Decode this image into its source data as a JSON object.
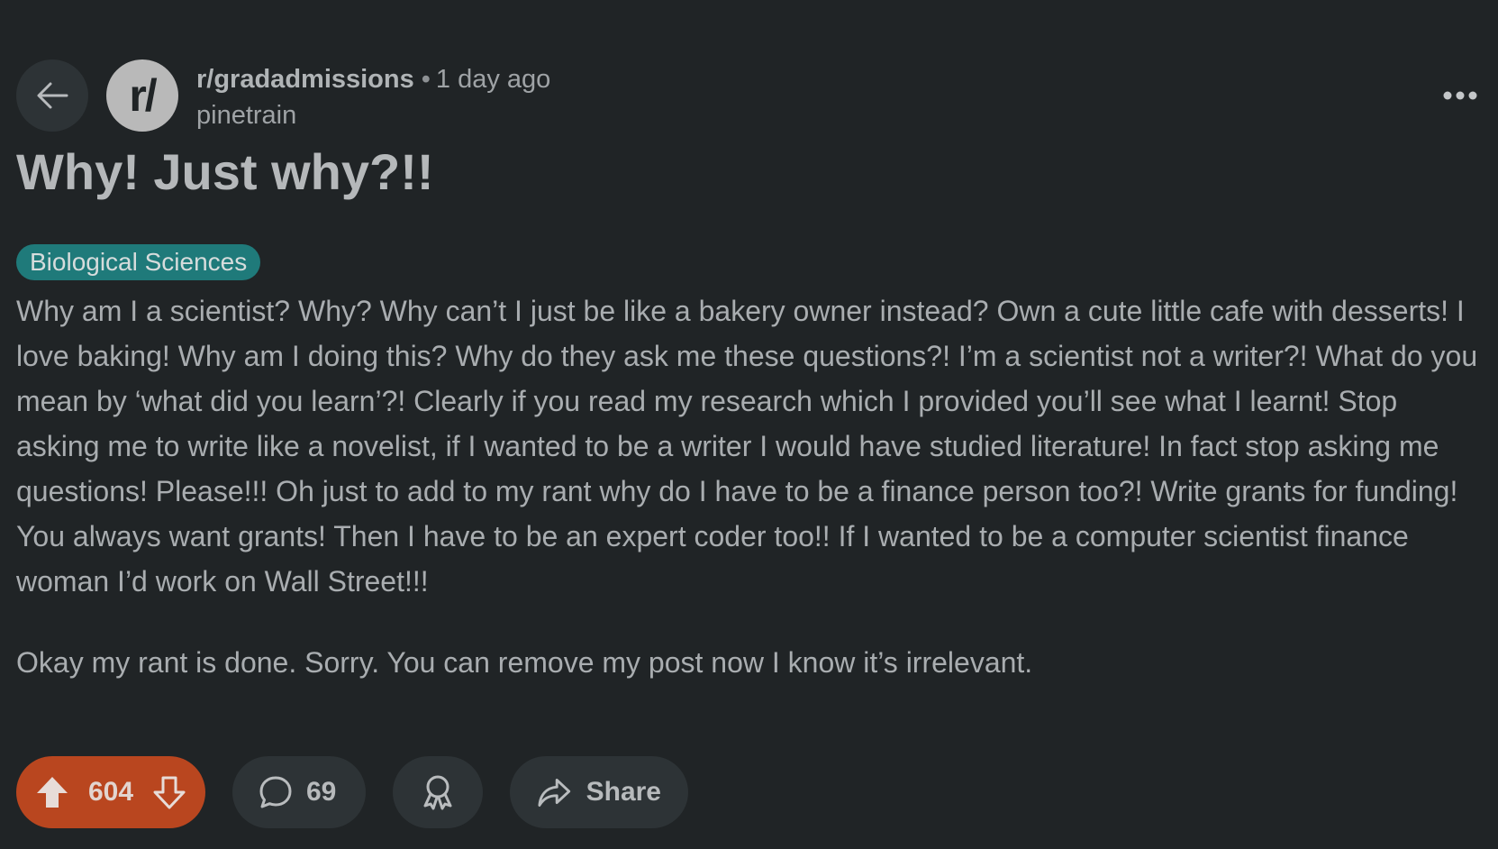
{
  "header": {
    "subreddit": "r/gradadmissions",
    "separator": "•",
    "time_ago": "1 day ago",
    "username": "pinetrain",
    "avatar_text": "r/"
  },
  "post": {
    "title": "Why! Just why?!!",
    "flair": "Biological Sciences",
    "flair_color": "#1f7a7a",
    "paragraphs": [
      "Why am I a scientist? Why? Why can’t I just be like a bakery owner instead? Own a cute little cafe with desserts! I love baking! Why am I doing this? Why do they ask me these questions?! I’m a scientist not a writer?! What do you mean by ‘what did you learn’?! Clearly if you read my research which I provided you’ll see what I learnt! Stop asking me to write like a novelist, if I wanted to be a writer I would have studied literature! In fact stop asking me questions! Please!!! Oh just to add to my rant why do I have to be a finance person too?! Write grants for funding! You always want grants! Then I have to be an expert coder too!! If I wanted to be a computer scientist finance woman I’d work on Wall Street!!!",
      "Okay my rant is done. Sorry. You can remove my post now I know it’s irrelevant."
    ]
  },
  "actions": {
    "votes": "604",
    "comments": "69",
    "share_label": "Share",
    "vote_color": "#b9461f"
  },
  "icons": {
    "back": "arrow-left-icon",
    "more": "more-horizontal-icon",
    "upvote": "upvote-arrow-icon",
    "downvote": "downvote-arrow-icon",
    "comment": "comment-bubble-icon",
    "award": "award-ribbon-icon",
    "share": "share-arrow-icon"
  }
}
